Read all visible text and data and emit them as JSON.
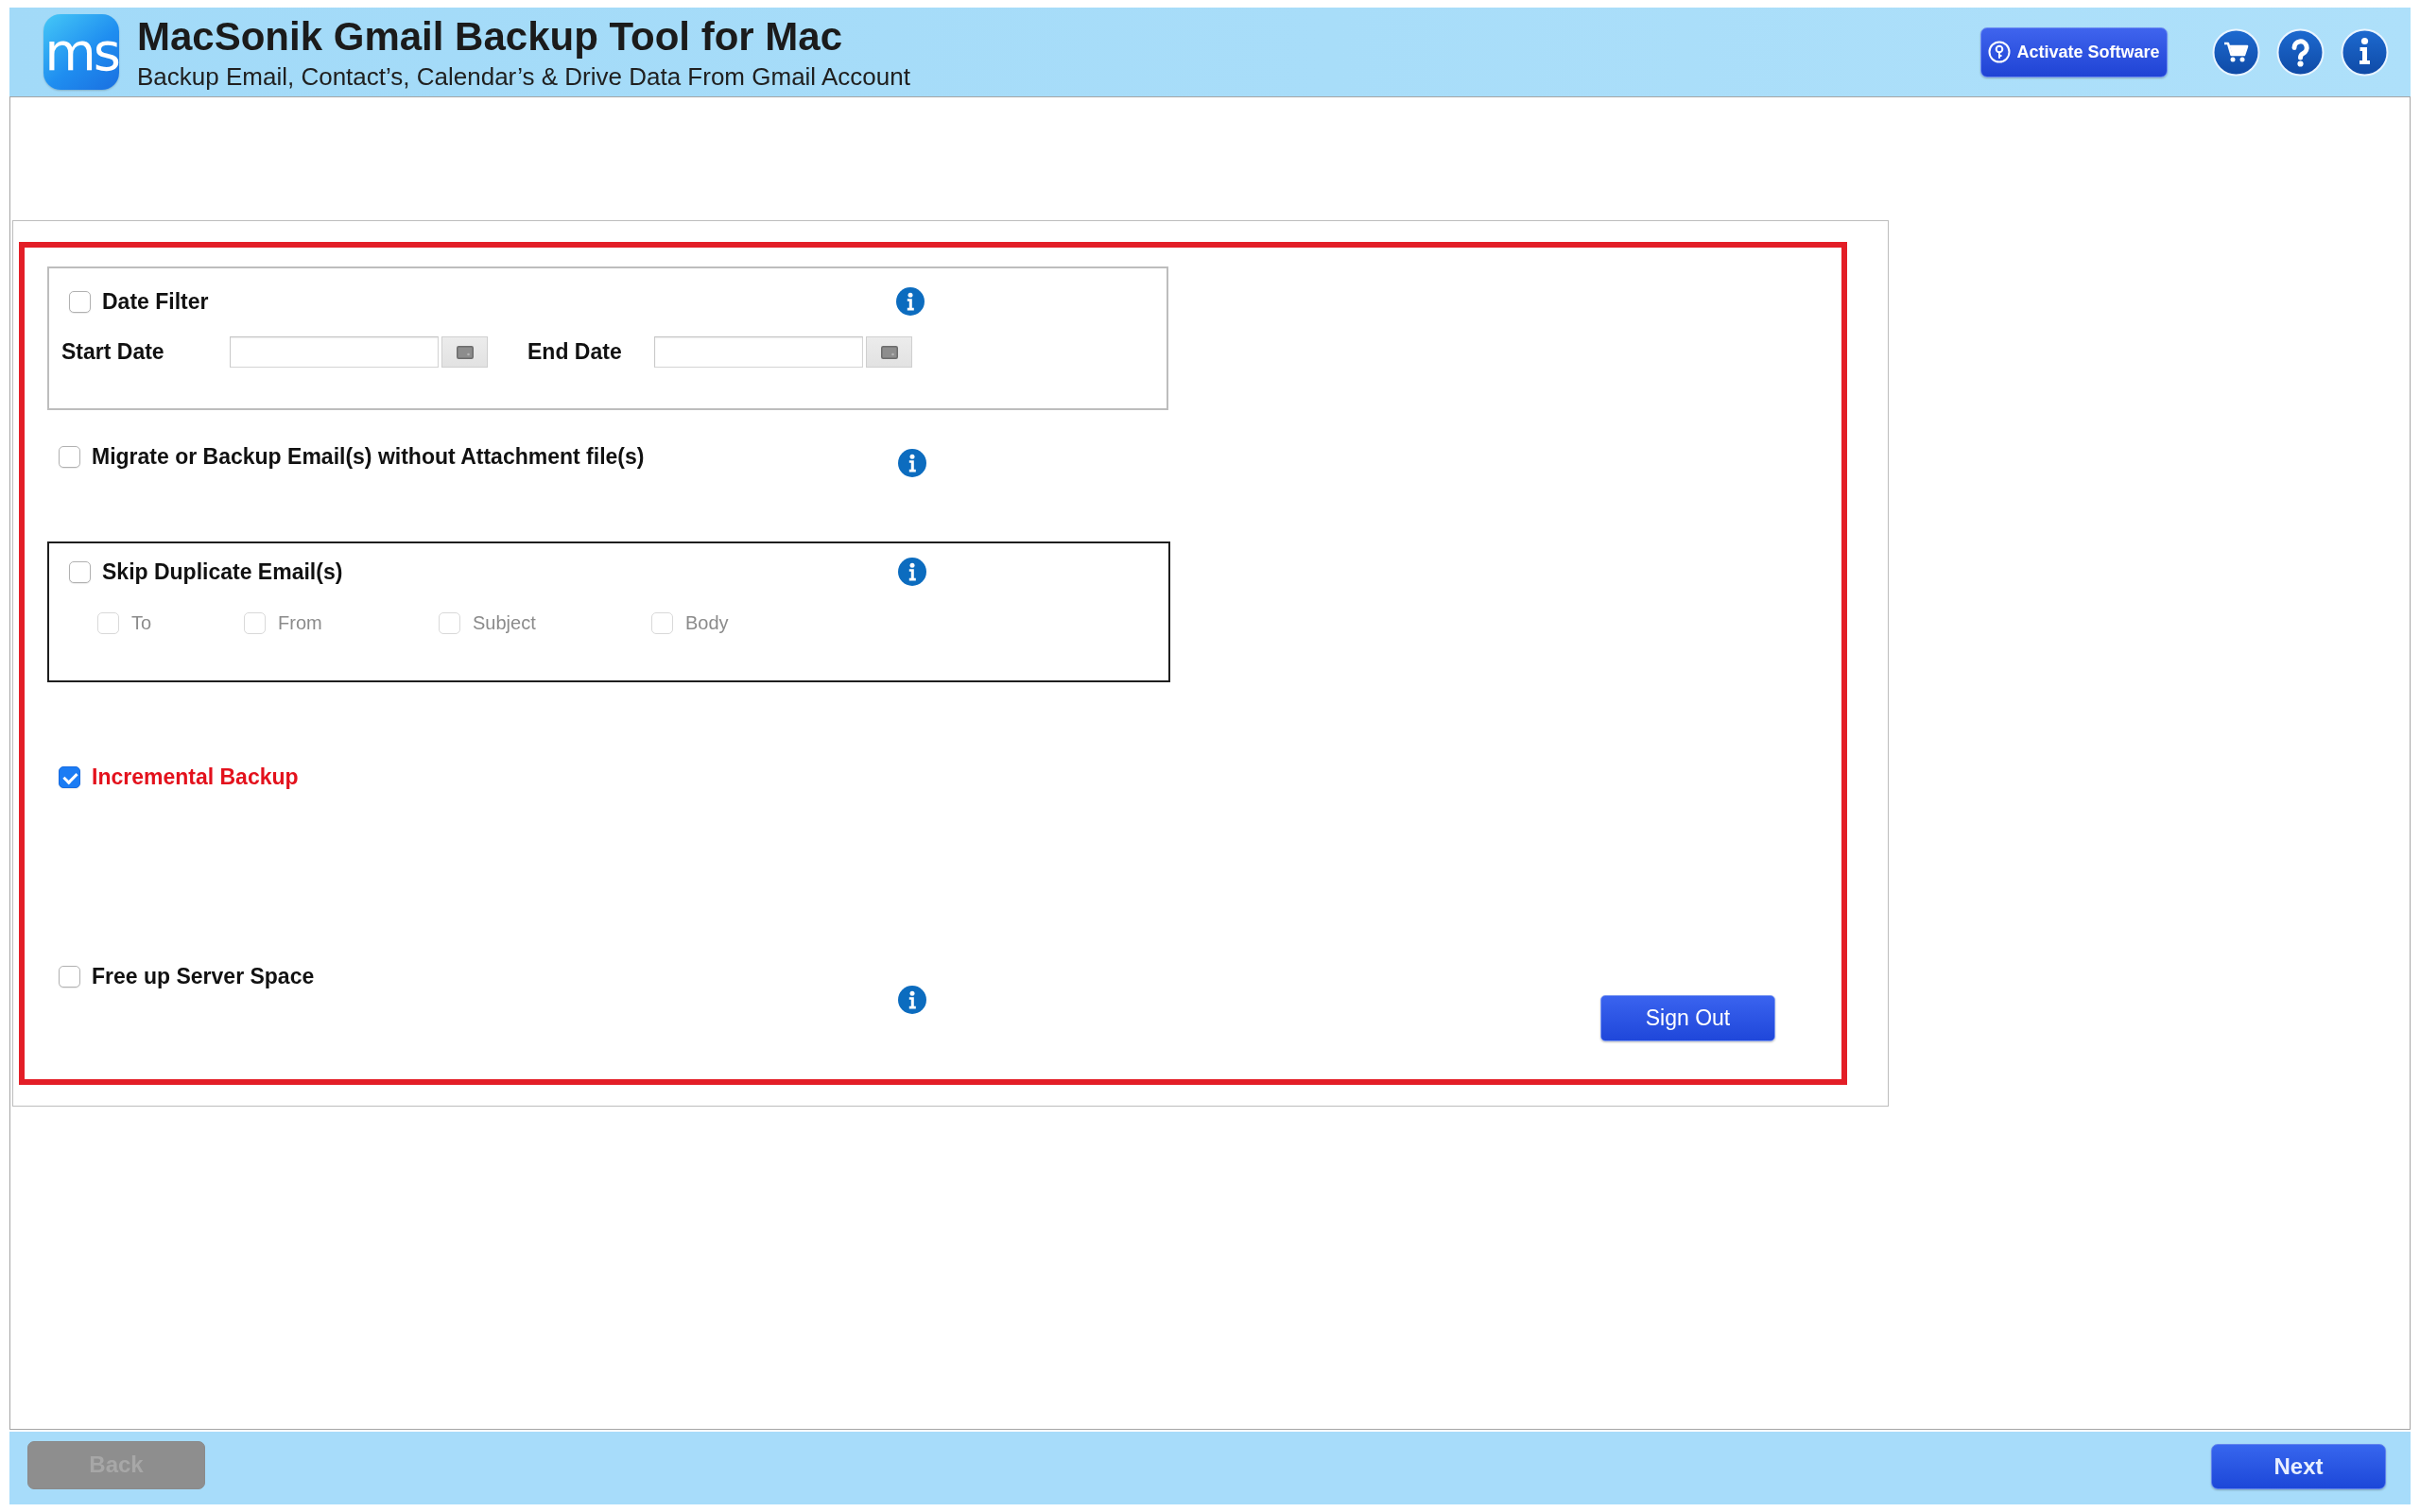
{
  "header": {
    "logo_text": "ms",
    "title": "MacSonik Gmail Backup Tool for Mac",
    "subtitle": "Backup Email, Contact’s, Calendar’s & Drive Data From Gmail Account",
    "activate_button": "Activate Software"
  },
  "date_filter": {
    "label": "Date Filter",
    "checked": false,
    "highlighted": false,
    "fields": [
      {
        "label": "Start Date"
      },
      {
        "label": "End Date"
      }
    ]
  },
  "without_attachments": {
    "label": "Migrate or Backup Email(s) without Attachment file(s)",
    "checked": false,
    "highlighted": false
  },
  "skip_duplicates": {
    "label": "Skip Duplicate Email(s)",
    "checked": false,
    "highlighted": false,
    "criteria": [
      {
        "label": "To",
        "checked": false,
        "disabled": true
      },
      {
        "label": "From",
        "checked": false,
        "disabled": true
      },
      {
        "label": "Subject",
        "checked": false,
        "disabled": true
      },
      {
        "label": "Body",
        "checked": false,
        "disabled": true
      }
    ]
  },
  "incremental_backup": {
    "label": "Incremental Backup",
    "checked": true,
    "highlighted": true
  },
  "free_server_space": {
    "label": "Free up Server Space",
    "checked": false,
    "highlighted": false
  },
  "sign_out_button": "Sign Out",
  "footer": {
    "back_button": {
      "label": "Back",
      "disabled": true
    },
    "next_button": {
      "label": "Next",
      "disabled": false
    }
  }
}
